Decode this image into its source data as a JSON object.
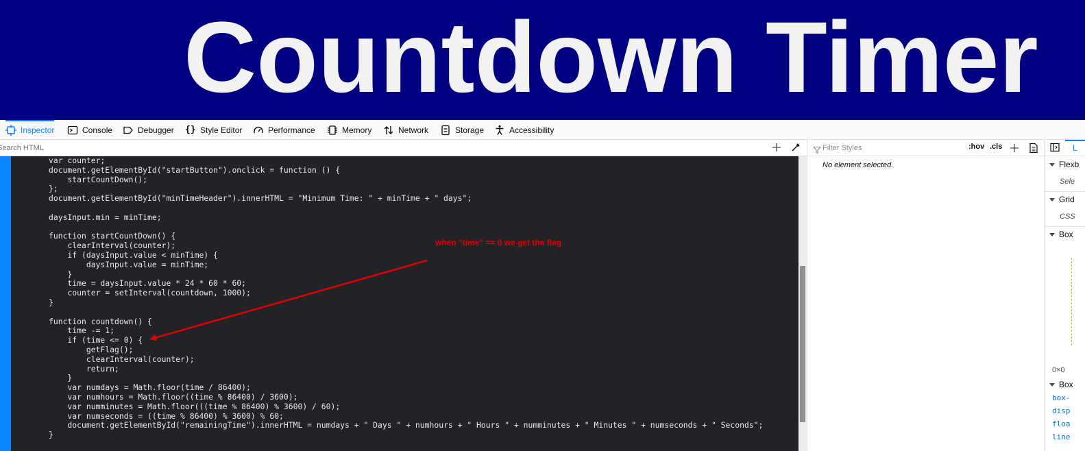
{
  "banner": {
    "title": "Countdown Timer"
  },
  "toolbar": {
    "tabs": [
      {
        "label": "Inspector",
        "icon": "inspector-icon",
        "active": true
      },
      {
        "label": "Console",
        "icon": "console-icon",
        "active": false
      },
      {
        "label": "Debugger",
        "icon": "debugger-icon",
        "active": false
      },
      {
        "label": "Style Editor",
        "icon": "style-editor-icon",
        "active": false
      },
      {
        "label": "Performance",
        "icon": "performance-icon",
        "active": false
      },
      {
        "label": "Memory",
        "icon": "memory-icon",
        "active": false
      },
      {
        "label": "Network",
        "icon": "network-icon",
        "active": false
      },
      {
        "label": "Storage",
        "icon": "storage-icon",
        "active": false
      },
      {
        "label": "Accessibility",
        "icon": "accessibility-icon",
        "active": false
      }
    ]
  },
  "search": {
    "placeholder": "Search HTML"
  },
  "code": {
    "lines": [
      "var counter;",
      "document.getElementById(\"startButton\").onclick = function () {",
      "    startCountDown();",
      "};",
      "document.getElementById(\"minTimeHeader\").innerHTML = \"Minimum Time: \" + minTime + \" days\";",
      "",
      "daysInput.min = minTime;",
      "",
      "function startCountDown() {",
      "    clearInterval(counter);",
      "    if (daysInput.value < minTime) {",
      "        daysInput.value = minTime;",
      "    }",
      "    time = daysInput.value * 24 * 60 * 60;",
      "    counter = setInterval(countdown, 1000);",
      "}",
      "",
      "function countdown() {",
      "    time -= 1;",
      "    if (time <= 0) {",
      "        getFlag();",
      "        clearInterval(counter);",
      "        return;",
      "    }",
      "    var numdays = Math.floor(time / 86400);",
      "    var numhours = Math.floor((time % 86400) / 3600);",
      "    var numminutes = Math.floor(((time % 86400) % 3600) / 60);",
      "    var numseconds = ((time % 86400) % 3600) % 60;",
      "    document.getElementById(\"remainingTime\").innerHTML = numdays + \" Days \" + numhours + \" Hours \" + numminutes + \" Minutes \" + numseconds + \" Seconds\";",
      "}"
    ]
  },
  "annotation": {
    "text": "when \"time\" == 0 we get the flag",
    "color": "#e00000"
  },
  "rules": {
    "filter_placeholder": "Filter Styles",
    "hov": ":hov",
    "cls": ".cls",
    "empty_message": "No element selected."
  },
  "layout_panel": {
    "tab_label": "L",
    "flexbox_label": "Flexb",
    "flexbox_sub": "Sele",
    "grid_label": "Grid",
    "grid_sub": "CSS",
    "boxmodel_label": "Box",
    "size_text": "0×0",
    "box_label": "Box",
    "props": [
      "box-",
      "disp",
      "floa",
      "line"
    ]
  },
  "colors": {
    "banner_bg": "#000080",
    "accent": "#0a84ff",
    "code_bg": "#232327"
  }
}
